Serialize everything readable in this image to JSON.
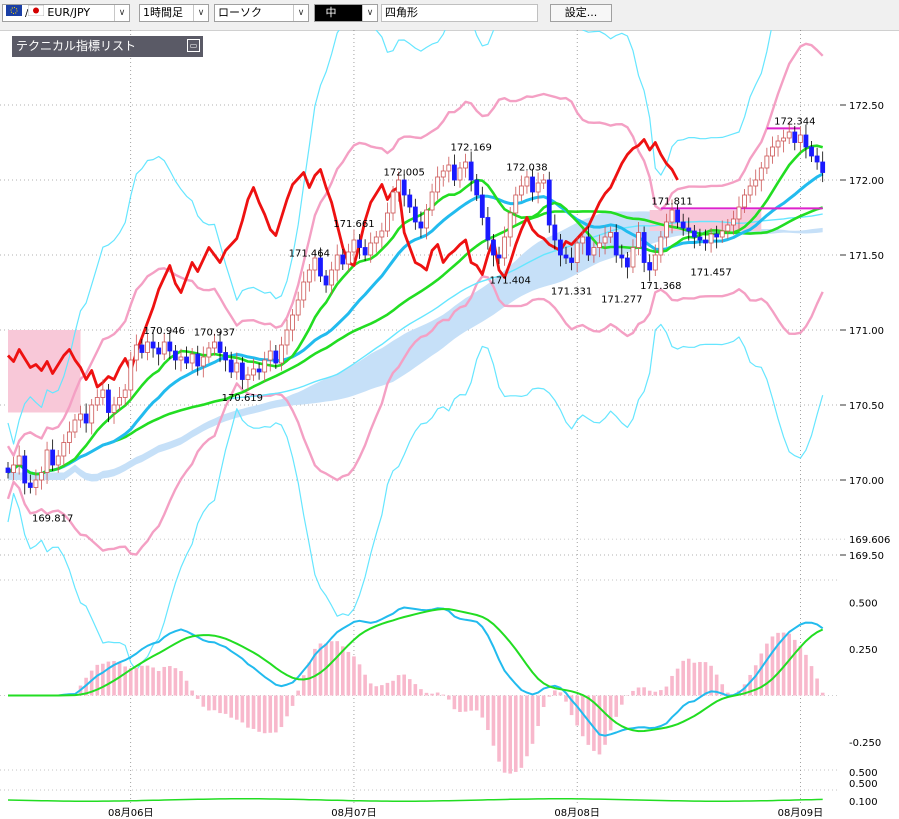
{
  "toolbar": {
    "symbol": "EUR/JPY",
    "timeframe": "1時間足",
    "chart_type": "ローソク",
    "line_width": "中",
    "shape": "四角形",
    "settings_label": "設定..."
  },
  "indicator_panel": {
    "title": "テクニカル指標リスト"
  },
  "colors": {
    "up_candle": "#e8a0a0",
    "down_candle": "#1a1aff",
    "bollinger_outer": "#66e6ff",
    "bollinger_inner": "#f4a0c4",
    "ma_green": "#22dd22",
    "ma_blue": "#22bbee",
    "red_line": "#ee1111",
    "cloud_blue": "#c6e0f8",
    "cloud_pink": "#f8c8d8",
    "marker_magenta": "#dd22cc",
    "macd_hist": "#f8b8cc"
  },
  "chart_data": [
    {
      "type": "candlestick",
      "price_axis": {
        "ticks": [
          "172.50",
          "172.00",
          "171.50",
          "171.00",
          "170.50",
          "170.00",
          "169.50"
        ],
        "tick_values": [
          172.5,
          172.0,
          171.5,
          171.0,
          170.5,
          170.0,
          169.5
        ],
        "current_price_label": "169.606",
        "ylim": [
          169.4,
          173.0
        ]
      },
      "x_axis": {
        "labels": [
          "08月06日",
          "08月07日",
          "08月08日",
          "08月09日"
        ],
        "label_index": [
          22,
          62,
          102,
          142
        ]
      },
      "annotations": [
        {
          "text": "169.817",
          "value": 169.817,
          "index": 8
        },
        {
          "text": "170.946",
          "value": 170.946,
          "index": 28
        },
        {
          "text": "170.937",
          "value": 170.937,
          "index": 37
        },
        {
          "text": "170.619",
          "value": 170.619,
          "index": 42
        },
        {
          "text": "171.464",
          "value": 171.464,
          "index": 54
        },
        {
          "text": "171.661",
          "value": 171.661,
          "index": 62
        },
        {
          "text": "172.005",
          "value": 172.005,
          "index": 71
        },
        {
          "text": "172.169",
          "value": 172.169,
          "index": 83
        },
        {
          "text": "172.038",
          "value": 172.038,
          "index": 93
        },
        {
          "text": "171.404",
          "value": 171.404,
          "index": 90
        },
        {
          "text": "171.331",
          "value": 171.331,
          "index": 101
        },
        {
          "text": "171.277",
          "value": 171.277,
          "index": 110
        },
        {
          "text": "171.368",
          "value": 171.368,
          "index": 117
        },
        {
          "text": "171.811",
          "value": 171.811,
          "index": 119
        },
        {
          "text": "171.457",
          "value": 171.457,
          "index": 126
        },
        {
          "text": "172.344",
          "value": 172.344,
          "index": 141
        }
      ],
      "candles_close": [
        170.05,
        170.1,
        170.16,
        169.98,
        169.95,
        170.0,
        170.05,
        170.2,
        170.1,
        170.16,
        170.25,
        170.32,
        170.4,
        170.44,
        170.38,
        170.5,
        170.55,
        170.6,
        170.45,
        170.5,
        170.55,
        170.6,
        170.8,
        170.9,
        170.85,
        170.92,
        170.88,
        170.84,
        170.92,
        170.86,
        170.8,
        170.82,
        170.78,
        170.84,
        170.76,
        170.82,
        170.88,
        170.92,
        170.85,
        170.8,
        170.72,
        170.78,
        170.67,
        170.7,
        170.74,
        170.72,
        170.8,
        170.86,
        170.78,
        170.9,
        171.0,
        171.1,
        171.2,
        171.32,
        171.4,
        171.48,
        171.36,
        171.3,
        171.4,
        171.5,
        171.44,
        171.52,
        171.6,
        171.55,
        171.5,
        171.58,
        171.62,
        171.66,
        171.78,
        171.92,
        172.0,
        171.9,
        171.82,
        171.72,
        171.68,
        171.8,
        171.92,
        172.02,
        172.06,
        172.1,
        172.0,
        172.08,
        172.12,
        172.0,
        171.9,
        171.75,
        171.6,
        171.5,
        171.48,
        171.62,
        171.78,
        171.9,
        171.96,
        172.02,
        171.92,
        171.98,
        172.0,
        171.7,
        171.6,
        171.5,
        171.48,
        171.45,
        171.58,
        171.62,
        171.5,
        171.55,
        171.58,
        171.62,
        171.65,
        171.5,
        171.48,
        171.42,
        171.55,
        171.65,
        171.45,
        171.4,
        171.5,
        171.62,
        171.72,
        171.8,
        171.72,
        171.68,
        171.66,
        171.62,
        171.6,
        171.58,
        171.64,
        171.62,
        171.66,
        171.7,
        171.74,
        171.82,
        171.9,
        171.96,
        172.0,
        172.08,
        172.16,
        172.22,
        172.26,
        172.28,
        172.32,
        172.25,
        172.3,
        172.22,
        172.16,
        172.12,
        172.05
      ]
    },
    {
      "type": "macd",
      "axis": {
        "ticks": [
          "0.500",
          "0.250",
          "-0.250"
        ],
        "tick_values": [
          0.5,
          0.25,
          -0.25
        ],
        "ylim": [
          -0.4,
          0.62
        ]
      }
    },
    {
      "type": "oscillator",
      "axis": {
        "ticks": [
          "0.500",
          "0.500",
          "0.100"
        ]
      }
    }
  ]
}
